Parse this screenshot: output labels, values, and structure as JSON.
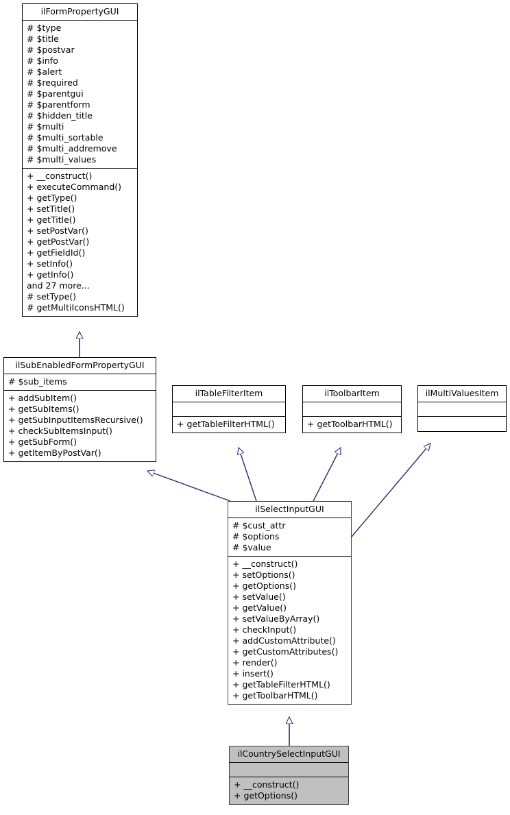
{
  "diagram": {
    "kind": "uml-class-diagram",
    "title": "ilCountrySelectInputGUI inheritance diagram",
    "edge_color": "#2a2a7a",
    "highlight_fill": "#c0c0c0",
    "box_fill": "#ffffff",
    "border_color": "#000000"
  },
  "classes": [
    {
      "id": "ilFormPropertyGUI",
      "name": "ilFormPropertyGUI",
      "highlighted": false,
      "attributes": [
        "# $type",
        "# $title",
        "# $postvar",
        "# $info",
        "# $alert",
        "# $required",
        "# $parentgui",
        "# $parentform",
        "# $hidden_title",
        "# $multi",
        "# $multi_sortable",
        "# $multi_addremove",
        "# $multi_values"
      ],
      "methods": [
        "+ __construct()",
        "+ executeCommand()",
        "+ getType()",
        "+ setTitle()",
        "+ getTitle()",
        "+ setPostVar()",
        "+ getPostVar()",
        "+ getFieldId()",
        "+ setInfo()",
        "+ getInfo()",
        "and 27 more...",
        "# setType()",
        "# getMultiIconsHTML()"
      ]
    },
    {
      "id": "ilSubEnabledFormPropertyGUI",
      "name": "ilSubEnabledFormPropertyGUI",
      "highlighted": false,
      "attributes": [
        "# $sub_items"
      ],
      "methods": [
        "+ addSubItem()",
        "+ getSubItems()",
        "+ getSubInputItemsRecursive()",
        "+ checkSubItemsInput()",
        "+ getSubForm()",
        "+ getItemByPostVar()"
      ]
    },
    {
      "id": "ilTableFilterItem",
      "name": "ilTableFilterItem",
      "highlighted": false,
      "attributes": [],
      "methods": [
        "+ getTableFilterHTML()"
      ]
    },
    {
      "id": "ilToolbarItem",
      "name": "ilToolbarItem",
      "highlighted": false,
      "attributes": [],
      "methods": [
        "+ getToolbarHTML()"
      ]
    },
    {
      "id": "ilMultiValuesItem",
      "name": "ilMultiValuesItem",
      "highlighted": false,
      "attributes": [],
      "methods": []
    },
    {
      "id": "ilSelectInputGUI",
      "name": "ilSelectInputGUI",
      "highlighted": false,
      "attributes": [
        "# $cust_attr",
        "# $options",
        "# $value"
      ],
      "methods": [
        "+ __construct()",
        "+ setOptions()",
        "+ getOptions()",
        "+ setValue()",
        "+ getValue()",
        "+ setValueByArray()",
        "+ checkInput()",
        "+ addCustomAttribute()",
        "+ getCustomAttributes()",
        "+ render()",
        "+ insert()",
        "+ getTableFilterHTML()",
        "+ getToolbarHTML()"
      ]
    },
    {
      "id": "ilCountrySelectInputGUI",
      "name": "ilCountrySelectInputGUI",
      "highlighted": true,
      "attributes": [],
      "methods": [
        "+ __construct()",
        "+ getOptions()"
      ]
    }
  ],
  "relations": [
    {
      "from": "ilSubEnabledFormPropertyGUI",
      "to": "ilFormPropertyGUI",
      "type": "generalization"
    },
    {
      "from": "ilSelectInputGUI",
      "to": "ilSubEnabledFormPropertyGUI",
      "type": "generalization"
    },
    {
      "from": "ilSelectInputGUI",
      "to": "ilTableFilterItem",
      "type": "generalization"
    },
    {
      "from": "ilSelectInputGUI",
      "to": "ilToolbarItem",
      "type": "generalization"
    },
    {
      "from": "ilSelectInputGUI",
      "to": "ilMultiValuesItem",
      "type": "generalization"
    },
    {
      "from": "ilCountrySelectInputGUI",
      "to": "ilSelectInputGUI",
      "type": "generalization"
    }
  ]
}
